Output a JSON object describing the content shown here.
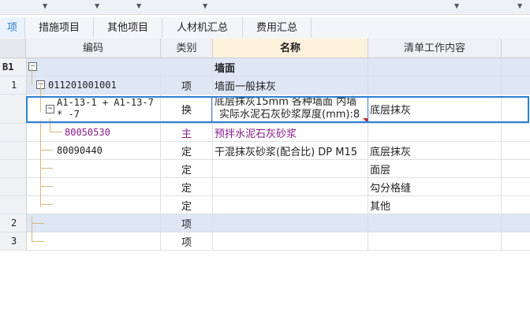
{
  "tabs": [
    {
      "label": "项",
      "active": true
    },
    {
      "label": "措施项目",
      "active": false
    },
    {
      "label": "其他项目",
      "active": false
    },
    {
      "label": "人材机汇总",
      "active": false
    },
    {
      "label": "费用汇总",
      "active": false
    }
  ],
  "columns": {
    "code": "编码",
    "type": "类别",
    "name": "名称",
    "work": "清单工作内容"
  },
  "rows": [
    {
      "no": "B1",
      "code": "",
      "type": "",
      "name": "墙面",
      "work": ""
    },
    {
      "no": "1",
      "code": "011201001001",
      "type": "项",
      "name": "墙面一般抹灰",
      "work": ""
    },
    {
      "no": "",
      "code_line1": "A1-13-1 + A1-13-7",
      "code_line2": "* -7",
      "type": "换",
      "name_line1": "底层抹灰15mm 各种墙面 内墙",
      "name_line2": "实际水泥石灰砂浆厚度(mm):8",
      "work": "底层抹灰"
    },
    {
      "no": "",
      "code": "80050530",
      "type": "主",
      "name": "预拌水泥石灰砂浆",
      "work": ""
    },
    {
      "no": "",
      "code": "80090440",
      "type": "定",
      "name": "干混抹灰砂浆(配合比) DP M15",
      "work": "底层抹灰"
    },
    {
      "no": "",
      "code": "",
      "type": "定",
      "name": "",
      "work": "面层"
    },
    {
      "no": "",
      "code": "",
      "type": "定",
      "name": "",
      "work": "勾分格缝"
    },
    {
      "no": "",
      "code": "",
      "type": "定",
      "name": "",
      "work": "其他"
    },
    {
      "no": "2",
      "code": "",
      "type": "项",
      "name": "",
      "work": ""
    },
    {
      "no": "3",
      "code": "",
      "type": "项",
      "name": "",
      "work": ""
    }
  ],
  "colors": {
    "accent": "#2d7fd3",
    "purple_text": "#8a1b8a",
    "level0_bg": "#dfe7f5"
  }
}
